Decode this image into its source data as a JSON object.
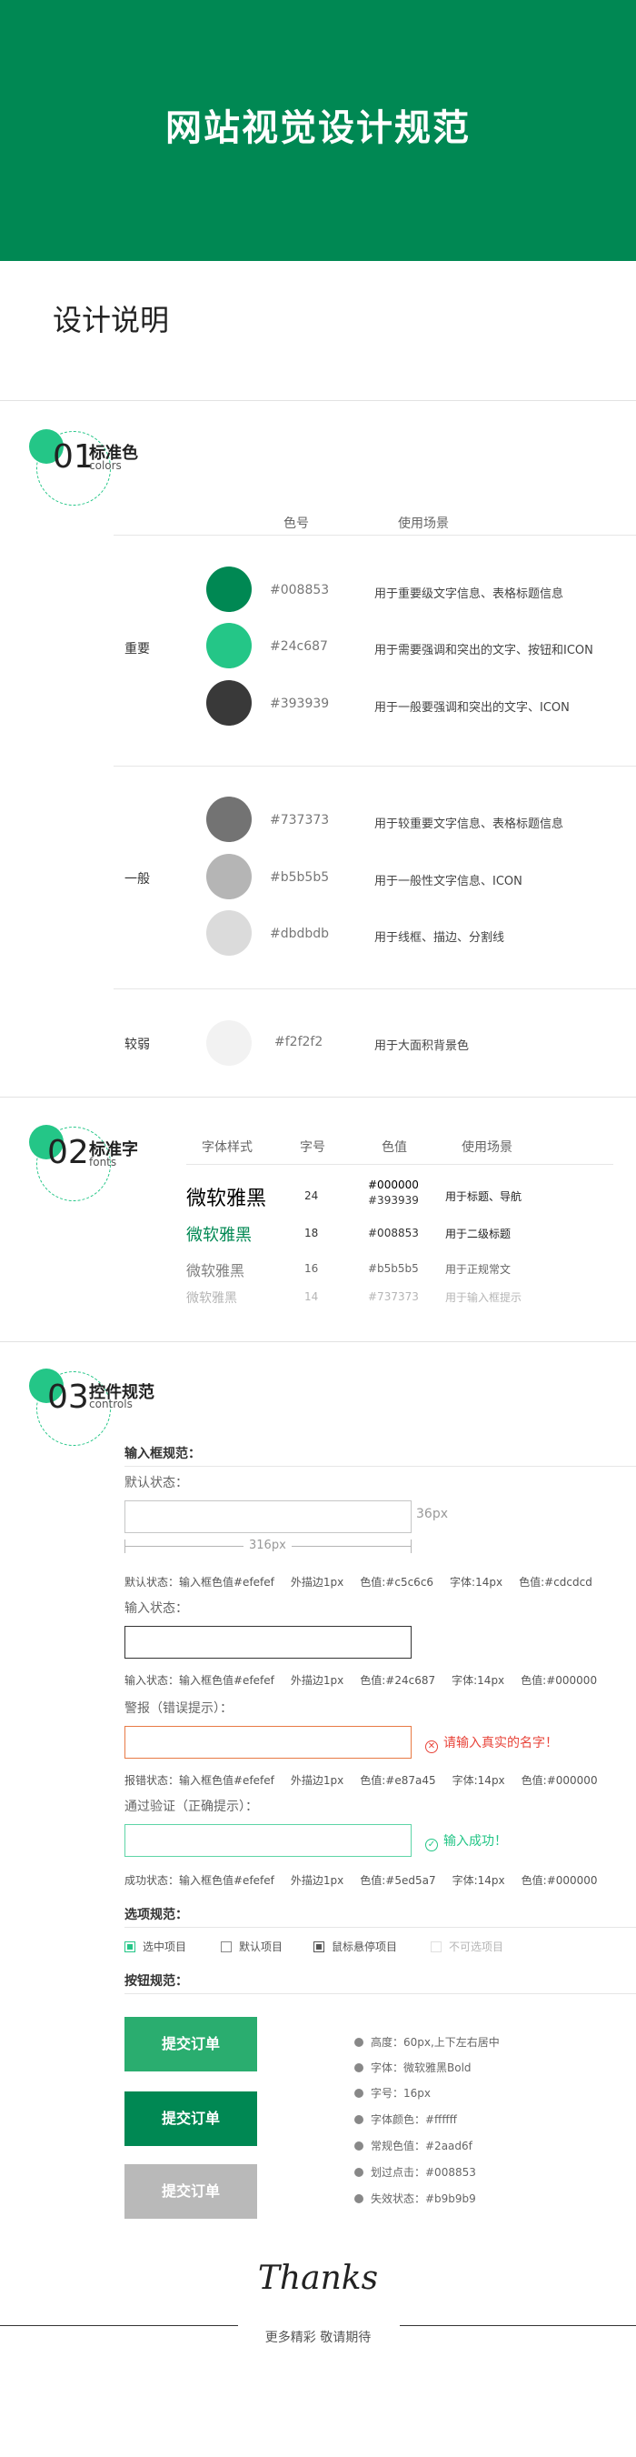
{
  "page_title": "网站视觉设计规范",
  "design_title": "设计说明",
  "colors": {
    "num": "01",
    "title": "标准色",
    "subtitle": "colors",
    "headers": {
      "code": "色号",
      "usage": "使用场景"
    },
    "groups": [
      {
        "label": "重要",
        "items": [
          {
            "hex": "#008853",
            "usage": "用于重要级文字信息、表格标题信息"
          },
          {
            "hex": "#24c687",
            "usage": "用于需要强调和突出的文字、按钮和ICON"
          },
          {
            "hex": "#393939",
            "usage": "用于一般要强调和突出的文字、ICON"
          }
        ]
      },
      {
        "label": "一般",
        "items": [
          {
            "hex": "#737373",
            "usage": "用于较重要文字信息、表格标题信息"
          },
          {
            "hex": "#b5b5b5",
            "usage": "用于一般性文字信息、ICON"
          },
          {
            "hex": "#dbdbdb",
            "usage": "用于线框、描边、分割线"
          }
        ]
      },
      {
        "label": "较弱",
        "items": [
          {
            "hex": "#f2f2f2",
            "usage": "用于大面积背景色"
          }
        ]
      }
    ]
  },
  "fonts": {
    "num": "02",
    "title": "标准字",
    "subtitle": "fonts",
    "headers": {
      "style": "字体样式",
      "size": "字号",
      "color": "色值",
      "usage": "使用场景"
    },
    "rows": [
      {
        "sample": "微软雅黑",
        "size": "24",
        "color1": "#000000",
        "color2": "#393939",
        "usage": "用于标题、导航"
      },
      {
        "sample": "微软雅黑",
        "size": "18",
        "color1": "#008853",
        "color2": "",
        "usage": "用于二级标题"
      },
      {
        "sample": "微软雅黑",
        "size": "16",
        "color1": "#b5b5b5",
        "color2": "",
        "usage": "用于正规常文"
      },
      {
        "sample": "微软雅黑",
        "size": "14",
        "color1": "#737373",
        "color2": "",
        "usage": "用于输入框提示"
      }
    ]
  },
  "controls": {
    "num": "03",
    "title": "控件规范",
    "subtitle": "controls",
    "input_title": "输入框规范：",
    "default_label": "默认状态：",
    "height_dim": "36px",
    "width_dim": "316px",
    "default_note": [
      "默认状态：输入框色值#efefef",
      "外描边1px",
      "色值:#c5c6c6",
      "字体:14px",
      "色值:#cdcdcd"
    ],
    "input_label": "输入状态：",
    "input_note": [
      "输入状态：输入框色值#efefef",
      "外描边1px",
      "色值:#24c687",
      "字体:14px",
      "色值:#000000"
    ],
    "error_label": "警报（错误提示）：",
    "error_msg": "请输入真实的名字！",
    "error_note": [
      "报错状态：输入框色值#efefef",
      "外描边1px",
      "色值:#e87a45",
      "字体:14px",
      "色值:#000000"
    ],
    "success_label": "通过验证（正确提示）：",
    "success_msg": "输入成功！",
    "success_note": [
      "成功状态：输入框色值#efefef",
      "外描边1px",
      "色值:#5ed5a7",
      "字体:14px",
      "色值:#000000"
    ],
    "option_title": "选项规范：",
    "options": [
      "选中项目",
      "默认项目",
      "鼠标悬停项目",
      "不可选项目"
    ],
    "button_title": "按钮规范：",
    "button_label": "提交订单",
    "button_specs": [
      "高度：60px,上下左右居中",
      "字体：微软雅黑Bold",
      "字号：16px",
      "字体颜色：#ffffff",
      "常规色值：#2aad6f",
      "划过点击：#008853",
      "失效状态：#b9b9b9"
    ]
  },
  "thanks": "Thanks",
  "thanks_sub": "更多精彩 敬请期待",
  "accent_colors": {
    "primary": "#008853",
    "accent": "#24c687",
    "error": "#e87a45",
    "success": "#5ed5a7",
    "button": "#2aad6f",
    "disabled": "#b9b9b9"
  }
}
